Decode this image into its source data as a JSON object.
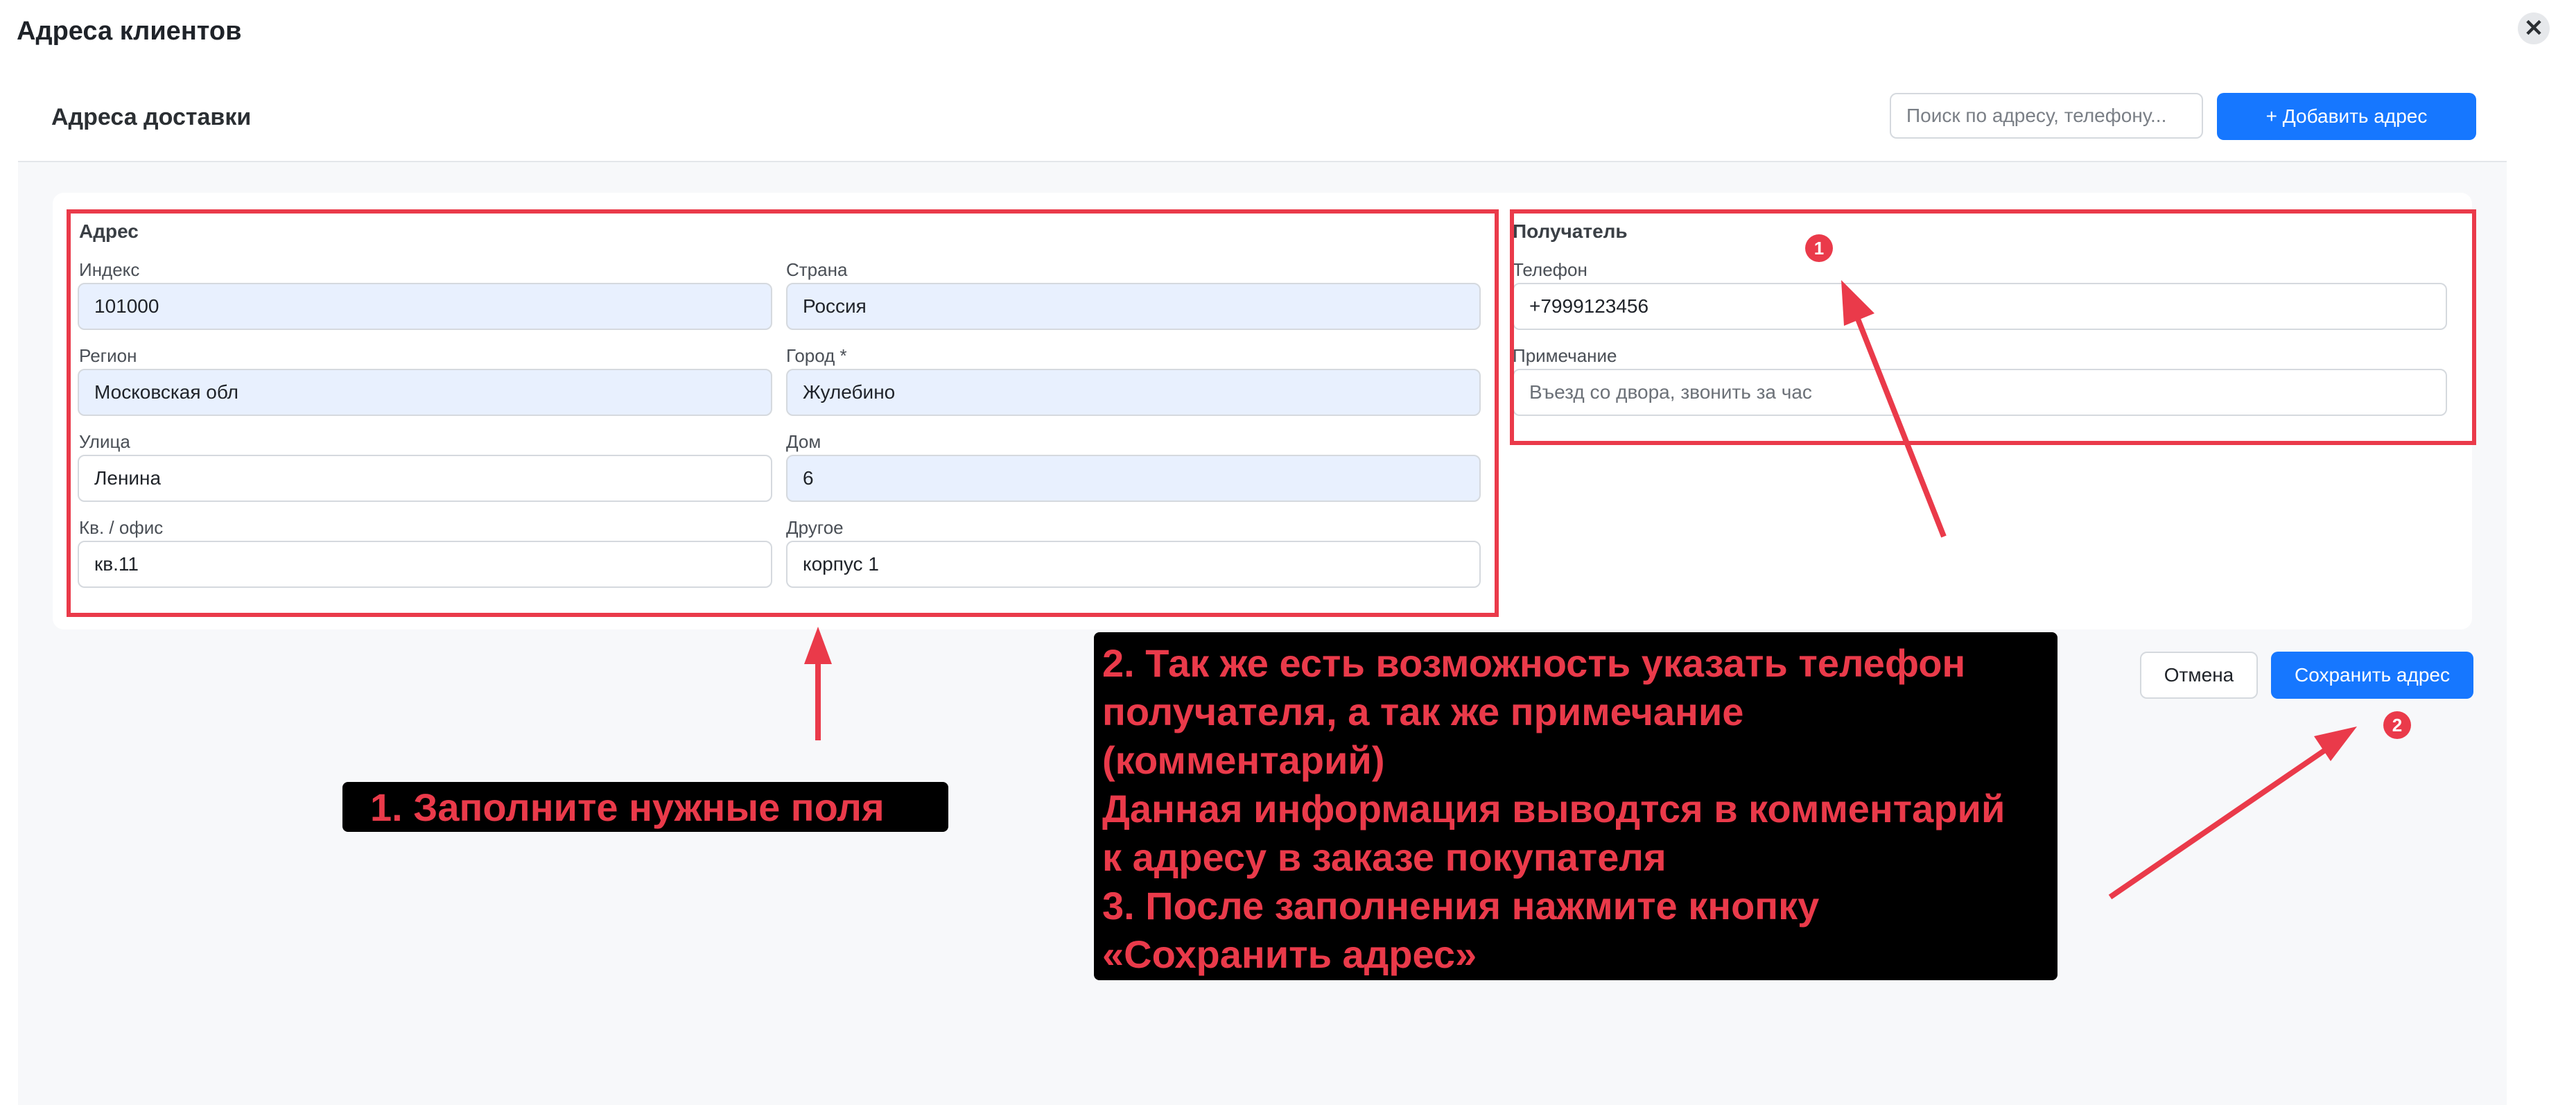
{
  "modal": {
    "title": "Адреса клиентов",
    "close_symbol": "✕"
  },
  "header": {
    "section_title": "Адреса доставки",
    "search_placeholder": "Поиск по адресу, телефону...",
    "add_button": "+ Добавить адрес"
  },
  "address": {
    "group_title": "Адрес",
    "fields": [
      {
        "label": "Индекс",
        "value": "101000"
      },
      {
        "label": "Страна",
        "value": "Россия"
      },
      {
        "label": "Регион",
        "value": "Московская обл"
      },
      {
        "label": "Город *",
        "value": "Жулебино"
      },
      {
        "label": "Улица",
        "value": "Ленина"
      },
      {
        "label": "Дом",
        "value": "6"
      },
      {
        "label": "Кв. / офис",
        "value": "кв.11"
      },
      {
        "label": "Другое",
        "value": "корпус 1"
      }
    ]
  },
  "recipient": {
    "group_title": "Получатель",
    "phone_label": "Телефон",
    "phone_value": "+7999123456",
    "note_label": "Примечание",
    "note_placeholder": "Въезд со двора, звонить за час"
  },
  "actions": {
    "cancel": "Отмена",
    "save": "Сохранить адрес"
  },
  "annotations": {
    "badge_1": "1",
    "badge_2": "2",
    "note_fill_fields": "1. Заполните нужные поля",
    "note_lines": [
      "2. Так же есть возможность указать телефон",
      "получателя, а так же примечание",
      "(комментарий)",
      "Данная информация выводтся в комментарий",
      "к адресу в заказе покупателя",
      "3. После заполнения нажмите кнопку",
      "«Сохранить адрес»"
    ],
    "color": "#ea3a4a"
  },
  "colors": {
    "primary": "#1677ff",
    "filled_field": "#e8f0fe",
    "annotation_red": "#ea3a4a"
  }
}
